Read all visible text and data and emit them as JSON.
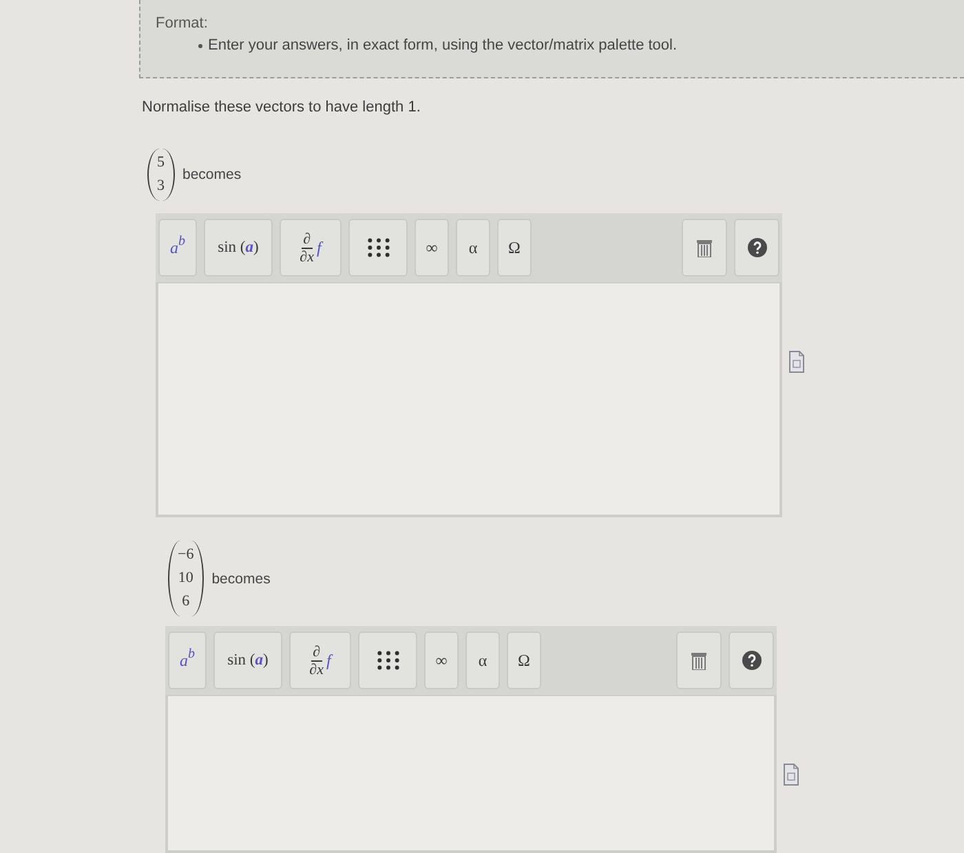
{
  "format_box": {
    "heading": "Format:",
    "bullets": [
      "Enter your answers, in exact form, using the vector/matrix palette tool."
    ]
  },
  "instruction": "Normalise these vectors to have length 1.",
  "questions": [
    {
      "vector": [
        "5",
        "3"
      ],
      "label": "becomes",
      "palette": {
        "buttons": [
          {
            "kind": "power",
            "base": "a",
            "exponent": "b"
          },
          {
            "kind": "function",
            "text": "sin (*a*)"
          },
          {
            "kind": "derivative",
            "numerator": "∂",
            "denominator": "∂x",
            "operand": "f"
          },
          {
            "kind": "matrix"
          },
          {
            "kind": "symbol",
            "text": "∞"
          },
          {
            "kind": "symbol",
            "text": "α"
          },
          {
            "kind": "symbol",
            "text": "Ω"
          }
        ],
        "tools": [
          {
            "kind": "delete"
          },
          {
            "kind": "help"
          }
        ]
      }
    },
    {
      "vector": [
        "−6",
        "10",
        "6"
      ],
      "label": "becomes",
      "palette": {
        "buttons": [
          {
            "kind": "power",
            "base": "a",
            "exponent": "b"
          },
          {
            "kind": "function",
            "text": "sin (*a*)"
          },
          {
            "kind": "derivative",
            "numerator": "∂",
            "denominator": "∂x",
            "operand": "f"
          },
          {
            "kind": "matrix"
          },
          {
            "kind": "symbol",
            "text": "∞"
          },
          {
            "kind": "symbol",
            "text": "α"
          },
          {
            "kind": "symbol",
            "text": "Ω"
          }
        ],
        "tools": [
          {
            "kind": "delete"
          },
          {
            "kind": "help"
          }
        ]
      }
    }
  ]
}
